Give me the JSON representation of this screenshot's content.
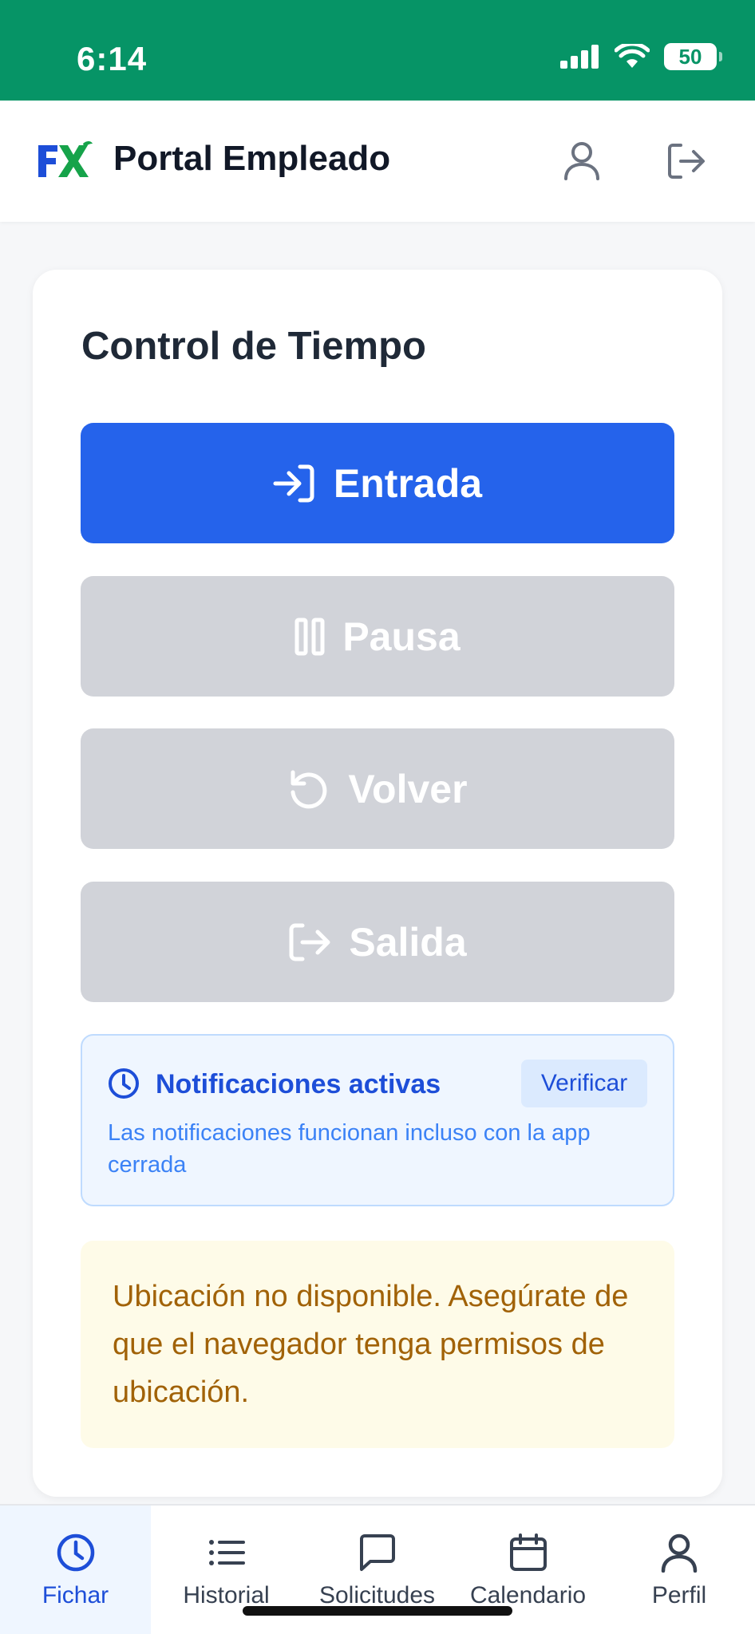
{
  "status_bar": {
    "time": "6:14",
    "battery": "50"
  },
  "header": {
    "title": "Portal Empleado",
    "logo_text": "FX"
  },
  "card": {
    "title": "Control de Tiempo",
    "buttons": {
      "entrada": "Entrada",
      "pausa": "Pausa",
      "volver": "Volver",
      "salida": "Salida"
    },
    "notifications": {
      "title": "Notificaciones activas",
      "verify": "Verificar",
      "description": "Las notificaciones funcionan incluso con la app cerrada"
    },
    "warning": "Ubicación no disponible. Asegúrate de que el navegador tenga permisos de ubicación."
  },
  "nav": [
    {
      "label": "Fichar",
      "icon": "clock-icon"
    },
    {
      "label": "Historial",
      "icon": "list-icon"
    },
    {
      "label": "Solicitudes",
      "icon": "chat-icon"
    },
    {
      "label": "Calendario",
      "icon": "calendar-icon"
    },
    {
      "label": "Perfil",
      "icon": "user-icon"
    }
  ],
  "colors": {
    "status_bar": "#069466",
    "primary": "#2563eb",
    "disabled": "#d1d3d9",
    "warning_text": "#a16207"
  }
}
